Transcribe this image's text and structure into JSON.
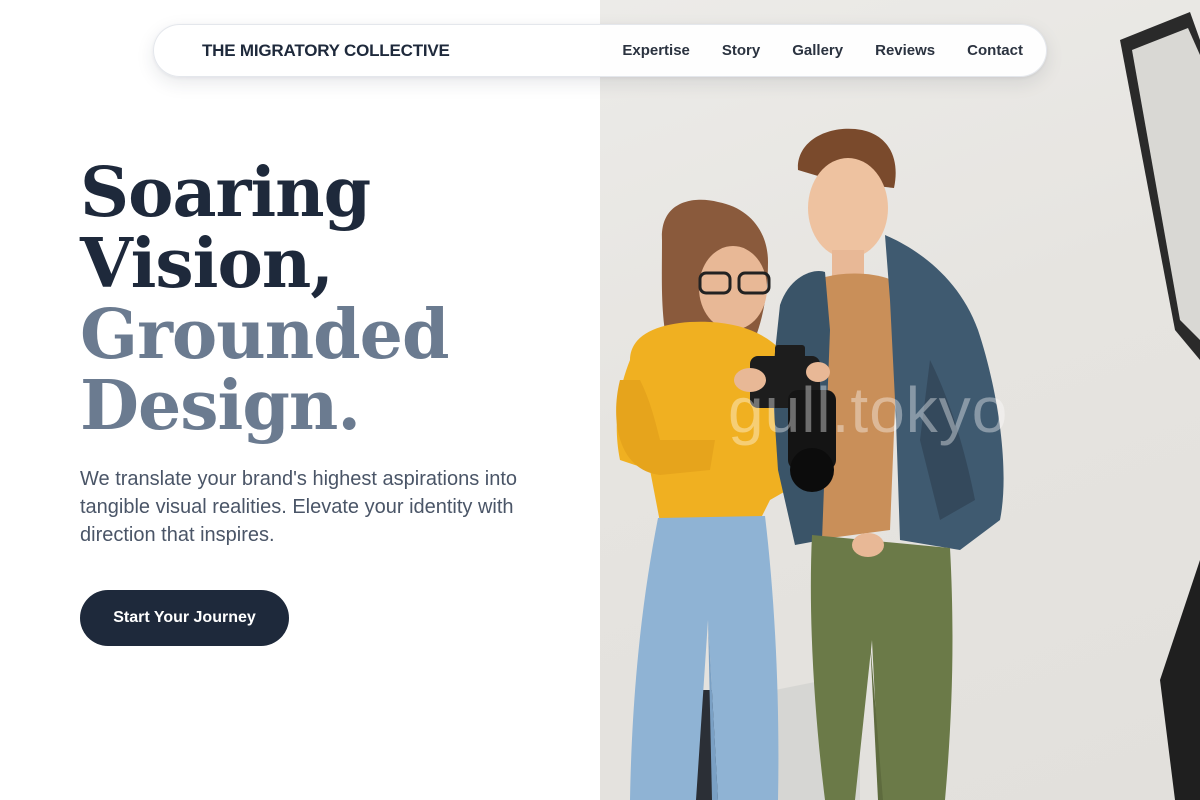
{
  "nav": {
    "brand": "THE MIGRATORY COLLECTIVE",
    "links": [
      "Expertise",
      "Story",
      "Gallery",
      "Reviews",
      "Contact"
    ]
  },
  "hero": {
    "title_line1": "Soaring",
    "title_line2": "Vision,",
    "title_line3": "Grounded",
    "title_line4": "Design.",
    "subtitle": "We translate your brand's highest aspirations into tangible visual realities. Elevate your identity with direction that inspires.",
    "cta_label": "Start Your Journey"
  },
  "photo": {
    "watermark": "gull.tokyo"
  },
  "colors": {
    "primary": "#1e293b",
    "muted_heading": "#6b7b90",
    "body_text": "#4a5567"
  }
}
